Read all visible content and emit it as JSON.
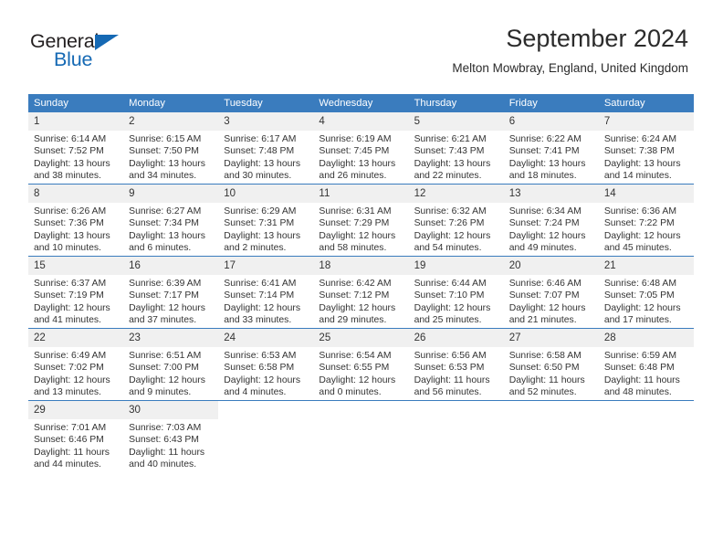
{
  "brand": {
    "name_part1": "General",
    "name_part2": "Blue",
    "triangle_color": "#1569b4"
  },
  "header": {
    "title": "September 2024",
    "subtitle": "Melton Mowbray, England, United Kingdom"
  },
  "theme": {
    "header_blue": "#3a7cbe",
    "daynum_bg": "#f0f0f0",
    "text": "#333333"
  },
  "calendar": {
    "weekday_headers": [
      "Sunday",
      "Monday",
      "Tuesday",
      "Wednesday",
      "Thursday",
      "Friday",
      "Saturday"
    ],
    "weeks": [
      [
        {
          "day": "1",
          "sunrise": "Sunrise: 6:14 AM",
          "sunset": "Sunset: 7:52 PM",
          "daylight1": "Daylight: 13 hours",
          "daylight2": "and 38 minutes."
        },
        {
          "day": "2",
          "sunrise": "Sunrise: 6:15 AM",
          "sunset": "Sunset: 7:50 PM",
          "daylight1": "Daylight: 13 hours",
          "daylight2": "and 34 minutes."
        },
        {
          "day": "3",
          "sunrise": "Sunrise: 6:17 AM",
          "sunset": "Sunset: 7:48 PM",
          "daylight1": "Daylight: 13 hours",
          "daylight2": "and 30 minutes."
        },
        {
          "day": "4",
          "sunrise": "Sunrise: 6:19 AM",
          "sunset": "Sunset: 7:45 PM",
          "daylight1": "Daylight: 13 hours",
          "daylight2": "and 26 minutes."
        },
        {
          "day": "5",
          "sunrise": "Sunrise: 6:21 AM",
          "sunset": "Sunset: 7:43 PM",
          "daylight1": "Daylight: 13 hours",
          "daylight2": "and 22 minutes."
        },
        {
          "day": "6",
          "sunrise": "Sunrise: 6:22 AM",
          "sunset": "Sunset: 7:41 PM",
          "daylight1": "Daylight: 13 hours",
          "daylight2": "and 18 minutes."
        },
        {
          "day": "7",
          "sunrise": "Sunrise: 6:24 AM",
          "sunset": "Sunset: 7:38 PM",
          "daylight1": "Daylight: 13 hours",
          "daylight2": "and 14 minutes."
        }
      ],
      [
        {
          "day": "8",
          "sunrise": "Sunrise: 6:26 AM",
          "sunset": "Sunset: 7:36 PM",
          "daylight1": "Daylight: 13 hours",
          "daylight2": "and 10 minutes."
        },
        {
          "day": "9",
          "sunrise": "Sunrise: 6:27 AM",
          "sunset": "Sunset: 7:34 PM",
          "daylight1": "Daylight: 13 hours",
          "daylight2": "and 6 minutes."
        },
        {
          "day": "10",
          "sunrise": "Sunrise: 6:29 AM",
          "sunset": "Sunset: 7:31 PM",
          "daylight1": "Daylight: 13 hours",
          "daylight2": "and 2 minutes."
        },
        {
          "day": "11",
          "sunrise": "Sunrise: 6:31 AM",
          "sunset": "Sunset: 7:29 PM",
          "daylight1": "Daylight: 12 hours",
          "daylight2": "and 58 minutes."
        },
        {
          "day": "12",
          "sunrise": "Sunrise: 6:32 AM",
          "sunset": "Sunset: 7:26 PM",
          "daylight1": "Daylight: 12 hours",
          "daylight2": "and 54 minutes."
        },
        {
          "day": "13",
          "sunrise": "Sunrise: 6:34 AM",
          "sunset": "Sunset: 7:24 PM",
          "daylight1": "Daylight: 12 hours",
          "daylight2": "and 49 minutes."
        },
        {
          "day": "14",
          "sunrise": "Sunrise: 6:36 AM",
          "sunset": "Sunset: 7:22 PM",
          "daylight1": "Daylight: 12 hours",
          "daylight2": "and 45 minutes."
        }
      ],
      [
        {
          "day": "15",
          "sunrise": "Sunrise: 6:37 AM",
          "sunset": "Sunset: 7:19 PM",
          "daylight1": "Daylight: 12 hours",
          "daylight2": "and 41 minutes."
        },
        {
          "day": "16",
          "sunrise": "Sunrise: 6:39 AM",
          "sunset": "Sunset: 7:17 PM",
          "daylight1": "Daylight: 12 hours",
          "daylight2": "and 37 minutes."
        },
        {
          "day": "17",
          "sunrise": "Sunrise: 6:41 AM",
          "sunset": "Sunset: 7:14 PM",
          "daylight1": "Daylight: 12 hours",
          "daylight2": "and 33 minutes."
        },
        {
          "day": "18",
          "sunrise": "Sunrise: 6:42 AM",
          "sunset": "Sunset: 7:12 PM",
          "daylight1": "Daylight: 12 hours",
          "daylight2": "and 29 minutes."
        },
        {
          "day": "19",
          "sunrise": "Sunrise: 6:44 AM",
          "sunset": "Sunset: 7:10 PM",
          "daylight1": "Daylight: 12 hours",
          "daylight2": "and 25 minutes."
        },
        {
          "day": "20",
          "sunrise": "Sunrise: 6:46 AM",
          "sunset": "Sunset: 7:07 PM",
          "daylight1": "Daylight: 12 hours",
          "daylight2": "and 21 minutes."
        },
        {
          "day": "21",
          "sunrise": "Sunrise: 6:48 AM",
          "sunset": "Sunset: 7:05 PM",
          "daylight1": "Daylight: 12 hours",
          "daylight2": "and 17 minutes."
        }
      ],
      [
        {
          "day": "22",
          "sunrise": "Sunrise: 6:49 AM",
          "sunset": "Sunset: 7:02 PM",
          "daylight1": "Daylight: 12 hours",
          "daylight2": "and 13 minutes."
        },
        {
          "day": "23",
          "sunrise": "Sunrise: 6:51 AM",
          "sunset": "Sunset: 7:00 PM",
          "daylight1": "Daylight: 12 hours",
          "daylight2": "and 9 minutes."
        },
        {
          "day": "24",
          "sunrise": "Sunrise: 6:53 AM",
          "sunset": "Sunset: 6:58 PM",
          "daylight1": "Daylight: 12 hours",
          "daylight2": "and 4 minutes."
        },
        {
          "day": "25",
          "sunrise": "Sunrise: 6:54 AM",
          "sunset": "Sunset: 6:55 PM",
          "daylight1": "Daylight: 12 hours",
          "daylight2": "and 0 minutes."
        },
        {
          "day": "26",
          "sunrise": "Sunrise: 6:56 AM",
          "sunset": "Sunset: 6:53 PM",
          "daylight1": "Daylight: 11 hours",
          "daylight2": "and 56 minutes."
        },
        {
          "day": "27",
          "sunrise": "Sunrise: 6:58 AM",
          "sunset": "Sunset: 6:50 PM",
          "daylight1": "Daylight: 11 hours",
          "daylight2": "and 52 minutes."
        },
        {
          "day": "28",
          "sunrise": "Sunrise: 6:59 AM",
          "sunset": "Sunset: 6:48 PM",
          "daylight1": "Daylight: 11 hours",
          "daylight2": "and 48 minutes."
        }
      ],
      [
        {
          "day": "29",
          "sunrise": "Sunrise: 7:01 AM",
          "sunset": "Sunset: 6:46 PM",
          "daylight1": "Daylight: 11 hours",
          "daylight2": "and 44 minutes."
        },
        {
          "day": "30",
          "sunrise": "Sunrise: 7:03 AM",
          "sunset": "Sunset: 6:43 PM",
          "daylight1": "Daylight: 11 hours",
          "daylight2": "and 40 minutes."
        },
        {
          "day": "",
          "sunrise": "",
          "sunset": "",
          "daylight1": "",
          "daylight2": ""
        },
        {
          "day": "",
          "sunrise": "",
          "sunset": "",
          "daylight1": "",
          "daylight2": ""
        },
        {
          "day": "",
          "sunrise": "",
          "sunset": "",
          "daylight1": "",
          "daylight2": ""
        },
        {
          "day": "",
          "sunrise": "",
          "sunset": "",
          "daylight1": "",
          "daylight2": ""
        },
        {
          "day": "",
          "sunrise": "",
          "sunset": "",
          "daylight1": "",
          "daylight2": ""
        }
      ]
    ]
  }
}
